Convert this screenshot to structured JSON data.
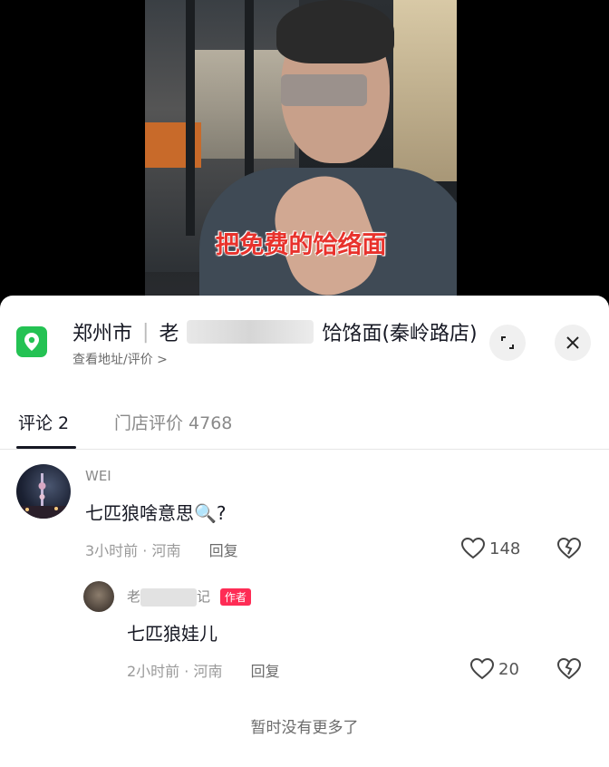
{
  "video": {
    "subtitle": "把免费的饸络面"
  },
  "store": {
    "name_prefix": "郑州市",
    "name_visible_1": "老",
    "name_suffix": "饸饹面(秦岭路店)",
    "sub_link": "查看地址/评价 >",
    "pin_color": "#24c253"
  },
  "tabs": {
    "comments": "评论 2",
    "reviews": "门店评价 4768"
  },
  "comments": [
    {
      "username": "WEI",
      "text": "七匹狼啥意思🔍?",
      "time": "3小时前",
      "location": "河南",
      "reply_label": "回复",
      "likes": "148"
    }
  ],
  "reply": {
    "username_prefix": "老",
    "username_suffix": "记",
    "badge": "作者",
    "text": "七匹狼娃儿",
    "time": "2小时前",
    "location": "河南",
    "reply_label": "回复",
    "likes": "20"
  },
  "footer": {
    "no_more": "暂时没有更多了"
  }
}
